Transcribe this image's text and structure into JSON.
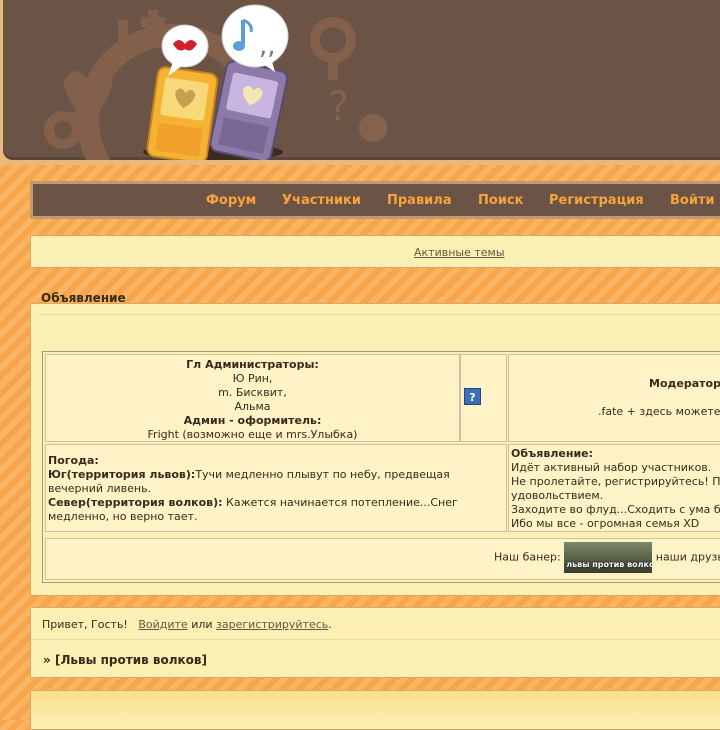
{
  "nav": {
    "forum": "Форум",
    "members": "Участники",
    "rules": "Правила",
    "search": "Поиск",
    "register": "Регистрация",
    "login": "Войти"
  },
  "active_topics": "Активные темы",
  "announcement": {
    "title": "Объявление",
    "admins_heading": "Гл Администраторы:",
    "admin1": "Ю Рин,",
    "admin2": "m. Бисквит,",
    "admin3": "Альма",
    "designer_heading": "Админ - оформитель:",
    "designer": "Fright (возможно еще и mrs.Улыбка)",
    "help_icon": "?",
    "moderators_heading": "Модератор",
    "moderators_text": ".fate + здесь можете",
    "weather_heading": "Погода:",
    "south_label": "Юг(территория львов):",
    "south_text": "Тучи медленно плывут по небу, предвещая вечерний ливень.",
    "north_label": "Север(территория волков):",
    "north_text": " Кажется начинается потепление...Снег медленно, но верно тает.",
    "notice_heading": "Объявление:",
    "notice_line1": "Идёт активный набор участников.",
    "notice_line2": "Не пролетайте, регистрируйтесь! П",
    "notice_line3": "удовольствием.",
    "notice_line4": "Заходите во флуд...Сходить с ума б",
    "notice_line5": "Ибо мы все - огромная семья XD",
    "banner_label": "Наш банер:",
    "banner_text": "львы против волков",
    "friends_label": "наши друзь"
  },
  "welcome": {
    "greeting": "Привет, Гость!",
    "login_link": "Войдите",
    "or": "или",
    "register_link": "зарегистрируйтесь",
    "dot": "."
  },
  "breadcrumb": {
    "prefix": "»",
    "forum_name": "[Львы против волков]"
  }
}
